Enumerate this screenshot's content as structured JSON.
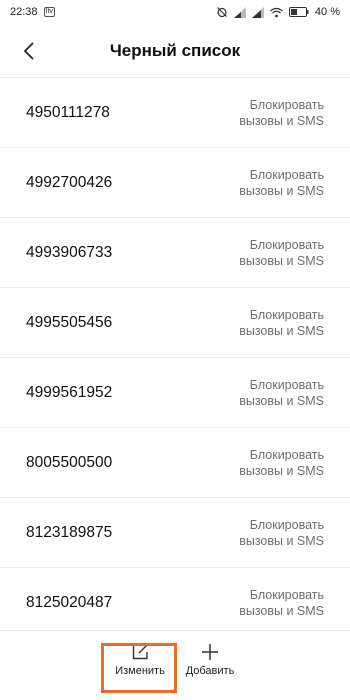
{
  "status_bar": {
    "time": "22:38",
    "notif_badge": "Itv",
    "battery_percent": "40 %",
    "icons": [
      "alarm-off-icon",
      "signal-icon",
      "signal-icon",
      "wifi-icon",
      "battery-icon"
    ]
  },
  "header": {
    "title": "Черный список",
    "back_icon": "chevron-left-icon"
  },
  "blacklist": {
    "items": [
      {
        "number": "4950111278",
        "mode_line1": "Блокировать",
        "mode_line2": "вызовы и SMS"
      },
      {
        "number": "4992700426",
        "mode_line1": "Блокировать",
        "mode_line2": "вызовы и SMS"
      },
      {
        "number": "4993906733",
        "mode_line1": "Блокировать",
        "mode_line2": "вызовы и SMS"
      },
      {
        "number": "4995505456",
        "mode_line1": "Блокировать",
        "mode_line2": "вызовы и SMS"
      },
      {
        "number": "4999561952",
        "mode_line1": "Блокировать",
        "mode_line2": "вызовы и SMS"
      },
      {
        "number": "8005500500",
        "mode_line1": "Блокировать",
        "mode_line2": "вызовы и SMS"
      },
      {
        "number": "8123189875",
        "mode_line1": "Блокировать",
        "mode_line2": "вызовы и SMS"
      },
      {
        "number": "8125020487",
        "mode_line1": "Блокировать",
        "mode_line2": "вызовы и SMS"
      }
    ]
  },
  "toolbar": {
    "edit_label": "Изменить",
    "edit_icon": "edit-icon",
    "add_label": "Добавить",
    "add_icon": "plus-icon"
  },
  "colors": {
    "highlight": "#ef6a24",
    "secondary_text": "#6f6f6f"
  }
}
